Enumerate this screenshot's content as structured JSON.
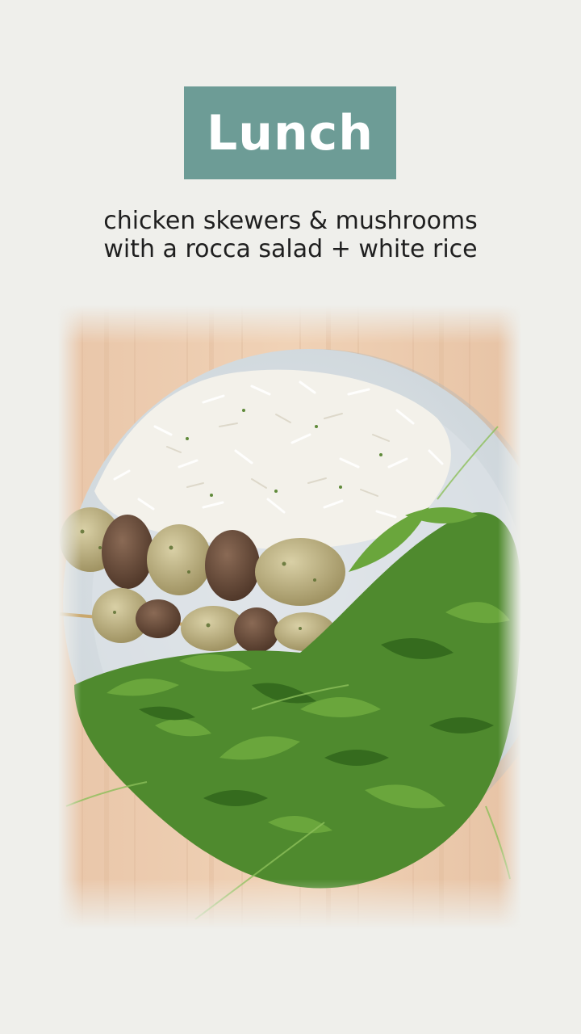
{
  "meal": {
    "title": "Lunch",
    "subtitle_line1": "chicken skewers & mushrooms",
    "subtitle_line2": "with a rocca salad + white rice"
  },
  "colors": {
    "background": "#efefeb",
    "badge": "#6d9c96",
    "badge_text": "#ffffff",
    "subtitle_text": "#1f1f1f"
  },
  "photo": {
    "subject": "plate of chicken and mushroom skewers, arugula salad and white rice on a bamboo board"
  }
}
